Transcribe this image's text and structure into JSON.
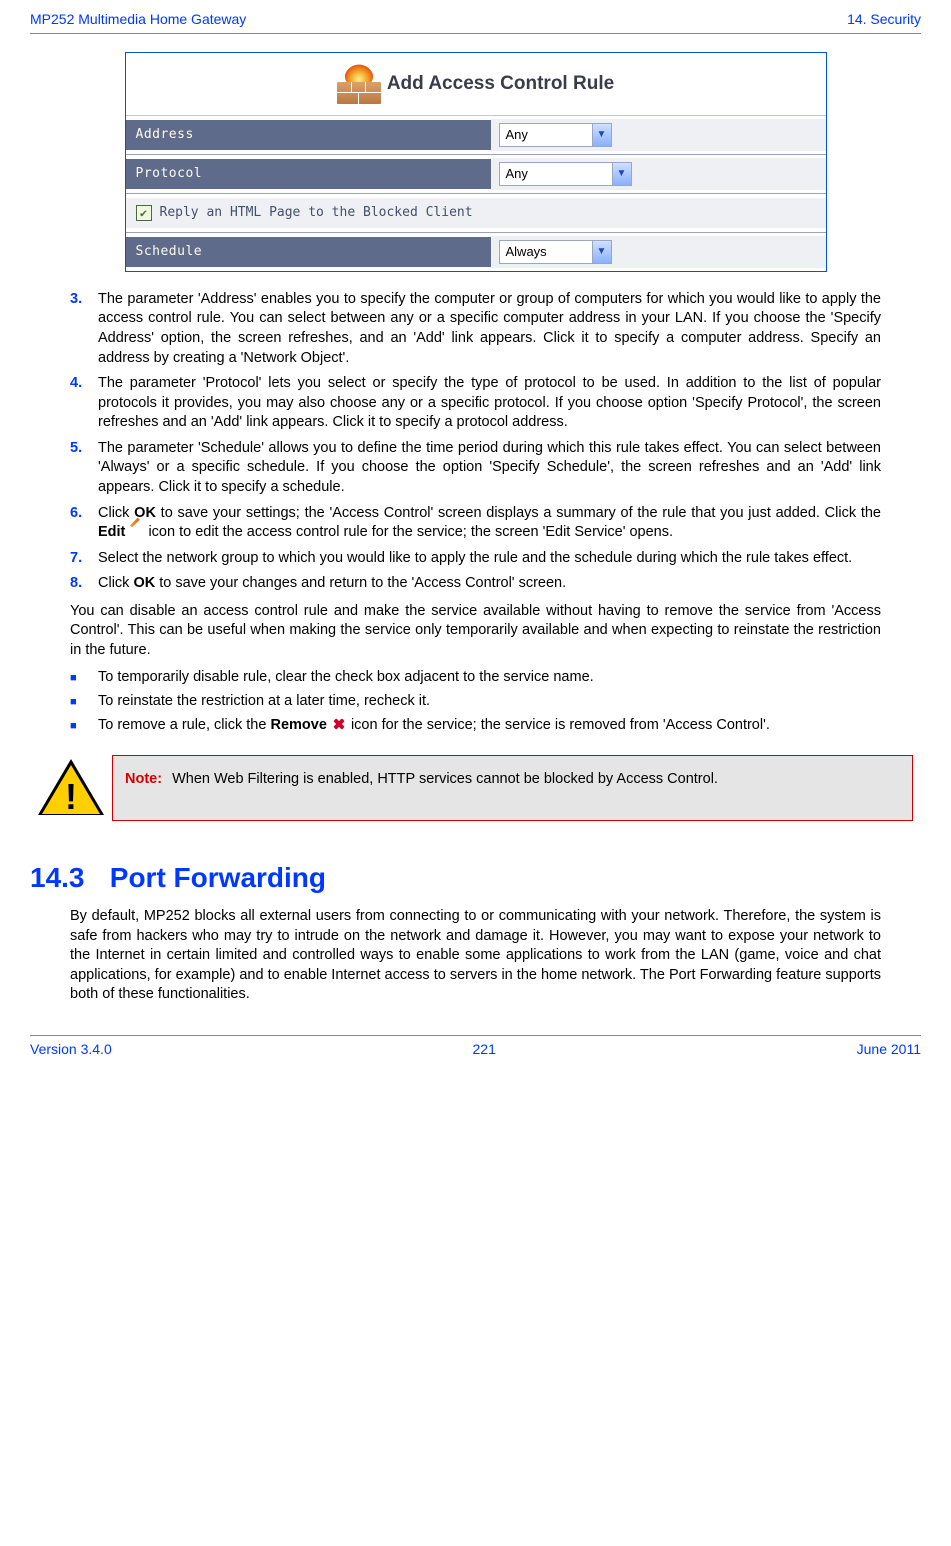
{
  "header": {
    "left": "MP252 Multimedia Home Gateway",
    "right": "14. Security"
  },
  "footer": {
    "left": "Version 3.4.0",
    "center": "221",
    "right": "June 2011"
  },
  "form": {
    "title": "Add Access Control Rule",
    "rows": {
      "address": {
        "label": "Address",
        "value": "Any"
      },
      "protocol": {
        "label": "Protocol",
        "value": "Any"
      },
      "reply": {
        "label": "Reply an HTML Page to the Blocked Client"
      },
      "schedule": {
        "label": "Schedule",
        "value": "Always"
      }
    }
  },
  "steps": {
    "s3": {
      "num": "3.",
      "text": "The parameter 'Address' enables you to specify the computer or group of computers for which you would like to apply the access control rule. You can select between any or a specific computer address in your LAN. If you choose the 'Specify Address' option, the screen refreshes, and an 'Add' link appears. Click it to specify a computer address. Specify an address by creating a 'Network Object'."
    },
    "s4": {
      "num": "4.",
      "text": "The parameter 'Protocol' lets you select or specify the type of protocol to be used. In addition to the list of popular protocols it provides, you may also choose any or a specific protocol. If you choose option 'Specify Protocol', the screen refreshes and an 'Add' link appears. Click it to specify a protocol address."
    },
    "s5": {
      "num": "5.",
      "text": "The parameter 'Schedule' allows you to define the time period during which this rule takes effect. You can select between 'Always' or a specific schedule. If you choose the option 'Specify Schedule', the screen refreshes and an 'Add' link appears. Click it to specify a schedule."
    },
    "s6": {
      "num": "6.",
      "pre": "Click ",
      "b1": "OK",
      "mid1": " to save your settings; the 'Access Control' screen displays a summary of the rule that you just added. Click the ",
      "b2": "Edit",
      "mid2": " icon to edit the access control rule for the service; the screen 'Edit Service' opens."
    },
    "s7": {
      "num": "7.",
      "text": "Select the network group to which you would like to apply the rule and the schedule during which the rule takes effect."
    },
    "s8": {
      "num": "8.",
      "pre": "Click ",
      "b1": "OK",
      "post": " to save your changes and return to the 'Access Control' screen."
    }
  },
  "para_after_steps": "You can disable an access control rule and make the service available without having to remove the service from 'Access Control'. This can be useful when making the service only temporarily available and when expecting to reinstate the restriction in the future.",
  "bullets": {
    "b1": "To temporarily disable rule, clear the check box adjacent to the service name.",
    "b2": "To reinstate the restriction at a later time, recheck it.",
    "b3_pre": "To remove a rule, click the ",
    "b3_bold": "Remove",
    "b3_post": " icon for the service; the service is removed from 'Access Control'."
  },
  "note": {
    "label": "Note:",
    "text": "When Web Filtering is enabled, HTTP services cannot be blocked by Access Control."
  },
  "section": {
    "num": "14.3",
    "title": "Port Forwarding",
    "body": "By default, MP252 blocks all external users from connecting to or communicating with your network. Therefore, the system is safe from hackers who may try to intrude on the network and damage it. However, you may want to expose your network to the Internet in certain limited and controlled ways to enable some applications to work from the LAN (game, voice and chat applications, for example) and to enable Internet access to servers in the home network. The Port Forwarding feature supports both of these functionalities."
  }
}
